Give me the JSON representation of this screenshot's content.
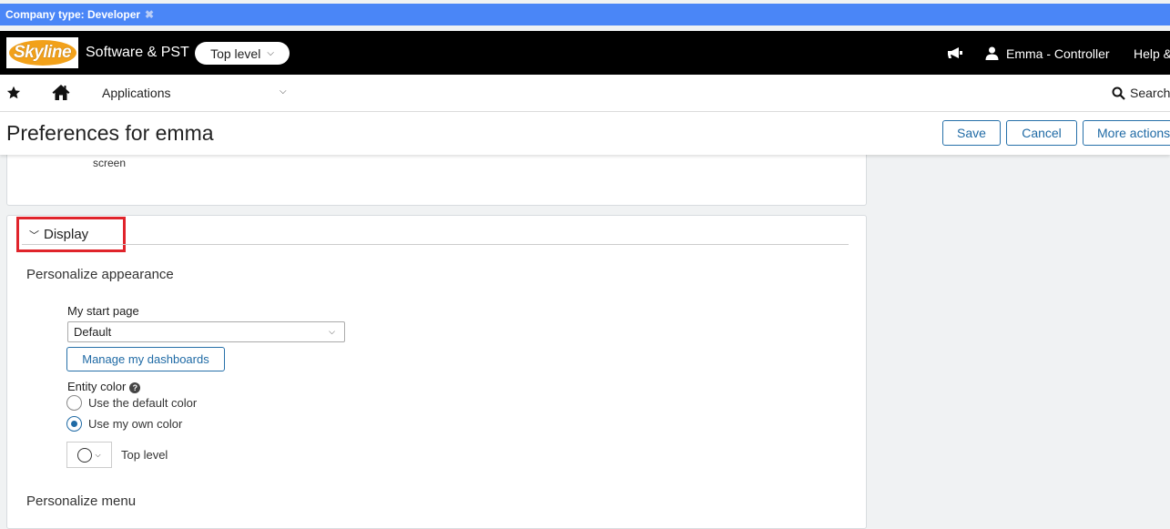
{
  "company_bar": {
    "label": "Company type: Developer",
    "close_glyph": "✖"
  },
  "topbar": {
    "logo_text": "Skyline",
    "company_name": "Software & PST",
    "level_selector": "Top level",
    "user_name": "Emma - Controller",
    "help_label": "Help &",
    "icons": [
      "megaphone-icon",
      "user-icon"
    ]
  },
  "navbar": {
    "applications_label": "Applications",
    "search_label": "Search",
    "icons": [
      "star-icon",
      "home-icon",
      "search-icon"
    ]
  },
  "page": {
    "title": "Preferences for emma",
    "actions": {
      "save": "Save",
      "cancel": "Cancel",
      "more": "More actions"
    }
  },
  "previous_section": {
    "trailing_text": "screen"
  },
  "display_section": {
    "header": "Display",
    "personalize_appearance": "Personalize appearance",
    "start_page": {
      "label": "My start page",
      "value": "Default"
    },
    "manage_dashboards": "Manage my dashboards",
    "entity_color": {
      "label": "Entity color",
      "help_glyph": "?",
      "options": [
        {
          "label": "Use the default color",
          "checked": false
        },
        {
          "label": "Use my own color",
          "checked": true
        }
      ],
      "color_target_label": "Top level"
    },
    "personalize_menu": "Personalize menu"
  },
  "colors": {
    "company_bar": "#4a86f7",
    "topbar": "#000000",
    "accent_blue": "#1f6aa5",
    "highlight_red": "#e0242b",
    "logo_orange": "#f2a11a"
  }
}
